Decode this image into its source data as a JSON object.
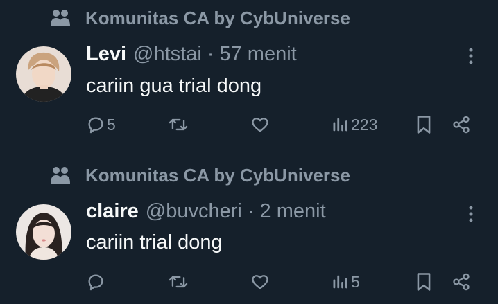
{
  "tweets": [
    {
      "community": "Komunitas CA by CybUniverse",
      "name": "Levi",
      "handle": "@htstai",
      "separator": "·",
      "time": "57 menit",
      "text": "cariin gua trial dong",
      "replies": "5",
      "views": "223"
    },
    {
      "community": "Komunitas CA by CybUniverse",
      "name": "claire",
      "handle": "@buvcheri",
      "separator": "·",
      "time": "2 menit",
      "text": "cariin trial dong",
      "replies": "",
      "views": "5"
    }
  ],
  "icons": {
    "community": "people-icon",
    "more": "more-vertical-icon",
    "reply": "reply-icon",
    "retweet": "retweet-icon",
    "like": "heart-icon",
    "views": "views-icon",
    "bookmark": "bookmark-icon",
    "share": "share-icon"
  },
  "colors": {
    "background": "#15202b",
    "text_primary": "#f7f9f9",
    "text_secondary": "#8b98a5",
    "divider": "#38444d"
  }
}
